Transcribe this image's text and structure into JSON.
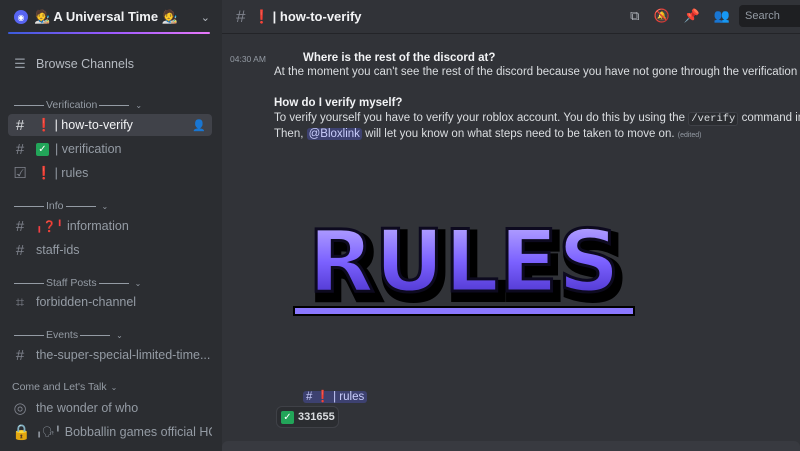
{
  "server": {
    "name": "🧑‍🎨 A Universal Time 🧑‍🎨",
    "icon": "server-logo-icon"
  },
  "sidebar": {
    "browse": "Browse Channels",
    "categories": [
      {
        "label": "Verification"
      },
      {
        "label": "Info"
      },
      {
        "label": "Staff Posts"
      },
      {
        "label": "Events"
      },
      {
        "label": "Come and Let's Talk"
      }
    ],
    "channels": [
      {
        "label": "| how-to-verify",
        "prefix": "❗"
      },
      {
        "label": "| verification",
        "prefix": "✅"
      },
      {
        "label": "| rules",
        "prefix": "❗"
      },
      {
        "label": "information",
        "prefix": "╻❓╹"
      },
      {
        "label": "staff-ids"
      },
      {
        "label": "forbidden-channel"
      },
      {
        "label": "the-super-special-limited-time..."
      },
      {
        "label": "the wonder of who"
      },
      {
        "label": "Bobballin games official HQ",
        "prefix": "╻🗣╹"
      }
    ]
  },
  "topbar": {
    "title": "| how-to-verify",
    "prefix": "❗",
    "search_placeholder": "Search"
  },
  "message": {
    "time": "04:30 AM",
    "q1": "Where is the rest of the discord at?",
    "a1": "At the moment you can't see the rest of the discord because you have not gone through the verification proce",
    "q2": "How do I verify myself?",
    "a2_pre": "To verify yourself you have to verify your roblox account. You do this by using the",
    "a2_code": "/verify",
    "a2_mid": "command in",
    "a3_pre": "Then,",
    "a3_mention": "@Bloxlink",
    "a3_post": "will let you know on what steps need to be taken to move on.",
    "edited": "(edited)",
    "banner_text": "RULES",
    "rules_chip": "| rules",
    "reaction_count": "331655"
  },
  "colors": {
    "accent": "#5865f2",
    "banner": "#7b61ff",
    "red": "#f23f43",
    "green": "#22a559"
  }
}
